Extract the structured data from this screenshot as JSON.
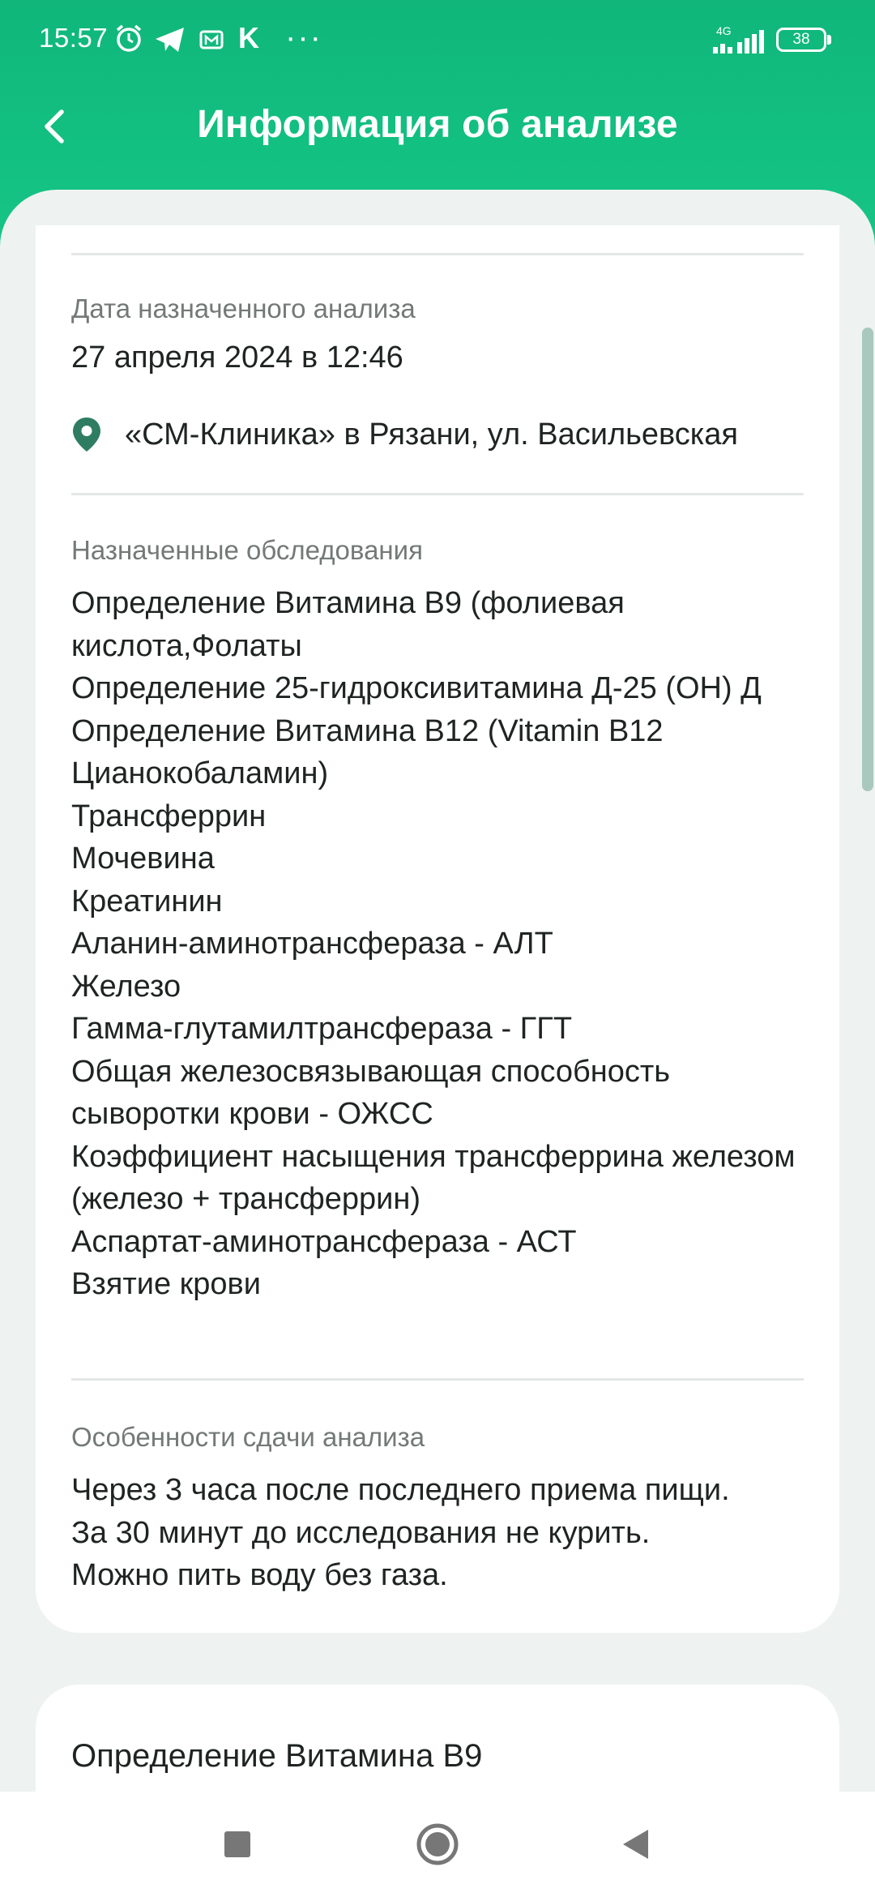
{
  "status_bar": {
    "time": "15:57",
    "network": "4G",
    "battery": "38",
    "icons": [
      "alarm-icon",
      "telegram-icon",
      "mail-icon",
      "k-icon",
      "more-dots-icon",
      "signal-icon",
      "battery-icon"
    ],
    "k_glyph": "K",
    "more_glyph": "···"
  },
  "app_bar": {
    "title": "Информация об анализе",
    "back_icon": "chevron-left-icon"
  },
  "appointment": {
    "date_label": "Дата назначенного анализа",
    "date_value": "27 апреля 2024 в 12:46",
    "location_icon": "map-pin-icon",
    "location": "«СМ-Клиника» в Рязани, ул. Васильевская"
  },
  "exams": {
    "label": "Назначенные обследования",
    "items": [
      "Определение Витамина В9 (фолиевая кислота,Фолаты",
      "Определение 25-гидроксивитамина Д-25 (ОН) Д",
      "Определение Витамина В12 (Vitamin B12 Цианокобаламин)",
      "Трансферрин",
      "Мочевина",
      "Креатинин",
      "Аланин-аминотрансфераза - АЛТ",
      "Железо",
      "Гамма-глутамилтрансфераза - ГГТ",
      "Общая железосвязывающая способность сыворотки крови - ОЖСС",
      "Коэффициент насыщения трансферрина железом (железо + трансферрин)",
      "Аспартат-аминотрансфераза - АСТ",
      "Взятие крови"
    ]
  },
  "preparation": {
    "label": "Особенности сдачи анализа",
    "lines": [
      "Через 3 часа после последнего приема пищи.",
      "За 30 минут до исследования не курить.",
      "Можно пить воду без газа."
    ]
  },
  "next_card": {
    "peek_text": "Определение Витамина В9"
  },
  "nav_bar": {
    "icons": [
      "recents-square-icon",
      "home-circle-icon",
      "back-triangle-icon"
    ]
  },
  "colors": {
    "brand_green": "#12BF80",
    "pin_green": "#2e7d62",
    "text": "#1f2423",
    "muted": "#737977"
  }
}
